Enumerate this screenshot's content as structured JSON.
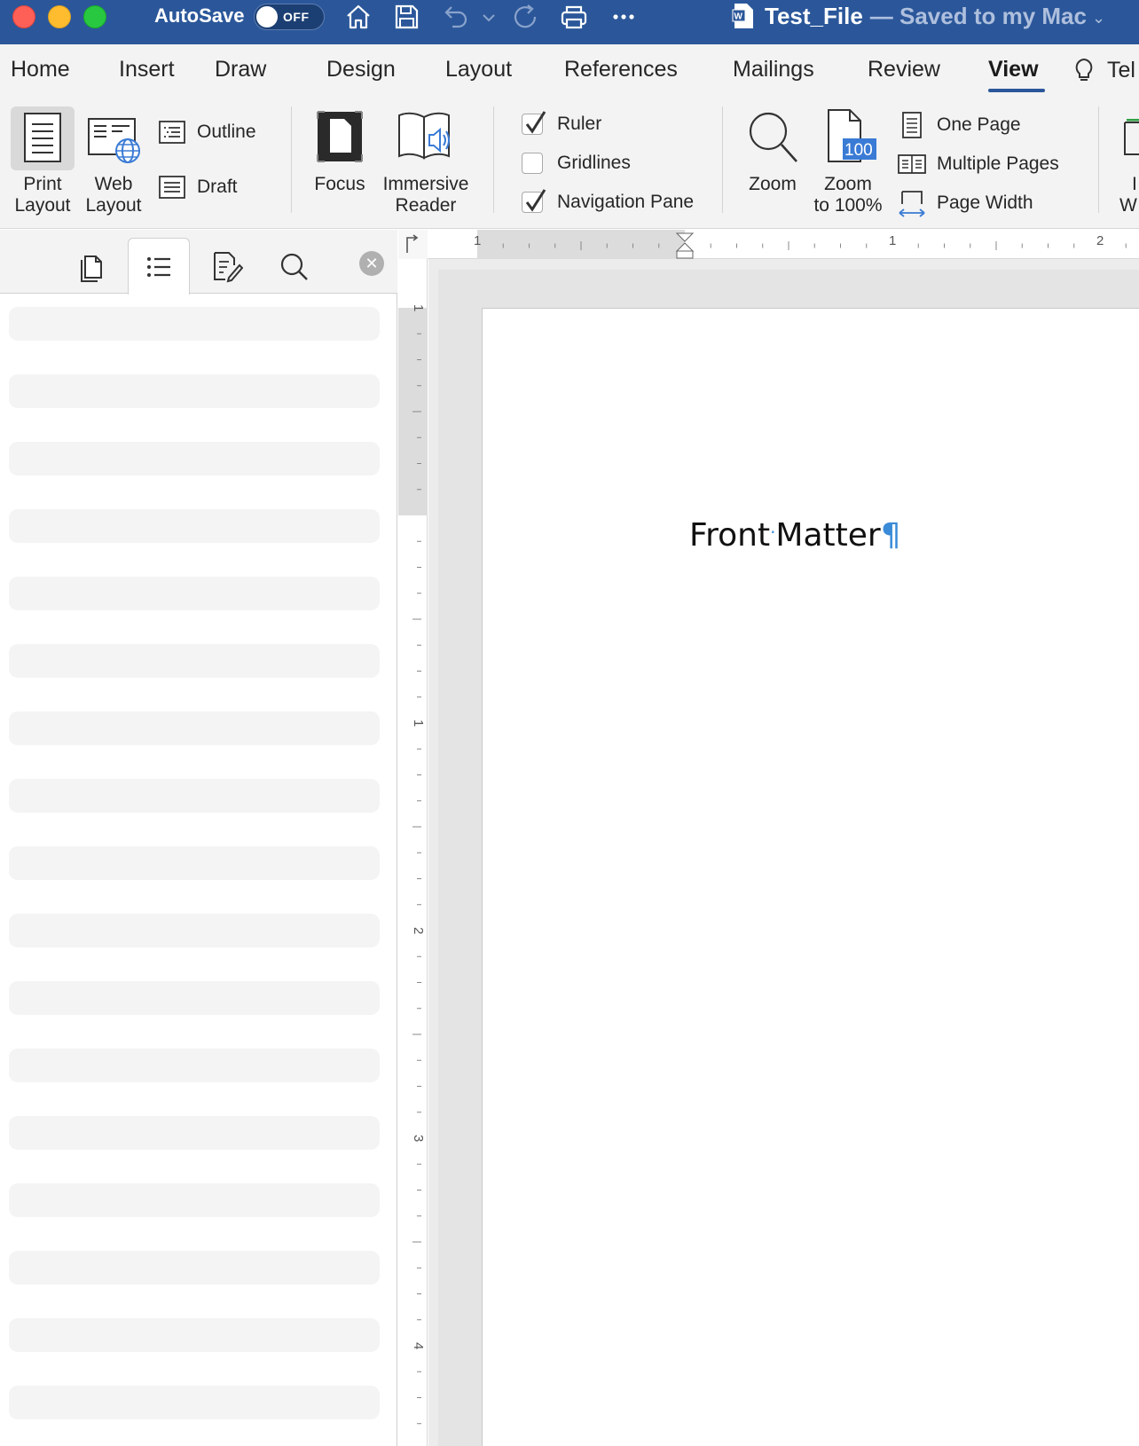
{
  "titlebar": {
    "autosave_label": "AutoSave",
    "autosave_state": "OFF",
    "doc_title": "Test_File",
    "doc_status": "— Saved to my Mac",
    "icons": [
      "home-icon",
      "save-icon",
      "undo-icon",
      "redo-icon",
      "print-icon",
      "more-icon"
    ]
  },
  "tabs": {
    "home": "Home",
    "insert": "Insert",
    "draw": "Draw",
    "design": "Design",
    "layout": "Layout",
    "references": "References",
    "mailings": "Mailings",
    "review": "Review",
    "view": "View",
    "tell": "Tel",
    "active": "View"
  },
  "ribbon": {
    "print_layout": [
      "Print",
      "Layout"
    ],
    "web_layout": [
      "Web",
      "Layout"
    ],
    "outline": "Outline",
    "draft": "Draft",
    "focus": "Focus",
    "immersive_reader": [
      "Immersive",
      "Reader"
    ],
    "ruler": "Ruler",
    "ruler_checked": true,
    "gridlines": "Gridlines",
    "gridlines_checked": false,
    "navigation_pane": "Navigation Pane",
    "navigation_pane_checked": true,
    "zoom": "Zoom",
    "zoom_100": [
      "Zoom",
      "to 100%"
    ],
    "zoom_100_badge": "100",
    "one_page": "One Page",
    "multiple_pages": "Multiple Pages",
    "page_width": "Page Width",
    "cut_off": [
      "I",
      "W"
    ]
  },
  "ruler": {
    "horizontal": [
      "1",
      "1",
      "2"
    ],
    "vertical": [
      "1",
      "1",
      "2",
      "3",
      "4"
    ]
  },
  "document": {
    "heading_word1": "Front",
    "space_mark": "·",
    "heading_word2": "Matter",
    "pilcrow": "¶"
  },
  "colors": {
    "titlebar": "#2b579a",
    "ribbon": "#f3f3f3",
    "accent": "#2b579a"
  }
}
